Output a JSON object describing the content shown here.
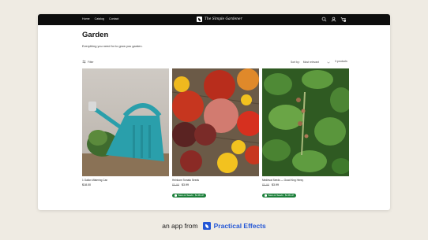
{
  "nav": {
    "items": [
      "Home",
      "Catalog",
      "Contact"
    ]
  },
  "brand": {
    "name": "The Simple Gardener"
  },
  "header_icons": [
    "search-icon",
    "account-icon",
    "cart-icon"
  ],
  "cart": {
    "count": "1"
  },
  "page": {
    "title": "Garden",
    "description": "Everything you need for to grow you garden."
  },
  "toolbar": {
    "filter_label": "Filter",
    "sort_label": "Sort by:",
    "sort_value": "Most relevant",
    "count_label": "3 products"
  },
  "products": [
    {
      "name": "1 Gallon Watering Can",
      "compare_price": "",
      "price": "$18.00",
      "badge": ""
    },
    {
      "name": "Heirloom Tomato Seeds",
      "compare_price": "$5.98",
      "price": "$3.99",
      "badge": "Save on Seeds · $1.99 off"
    },
    {
      "name": "Medieval Seeds — Good King Henry",
      "compare_price": "$5.98",
      "price": "$3.99",
      "badge": "Save on Seeds · $1.99 off"
    }
  ],
  "footer": {
    "prefix": "an app from",
    "brand": "Practical Effects"
  },
  "colors": {
    "topbar": "#0d0d0d",
    "badge": "#1b7f3a",
    "footer_brand": "#2457d6",
    "background": "#efebe3"
  }
}
